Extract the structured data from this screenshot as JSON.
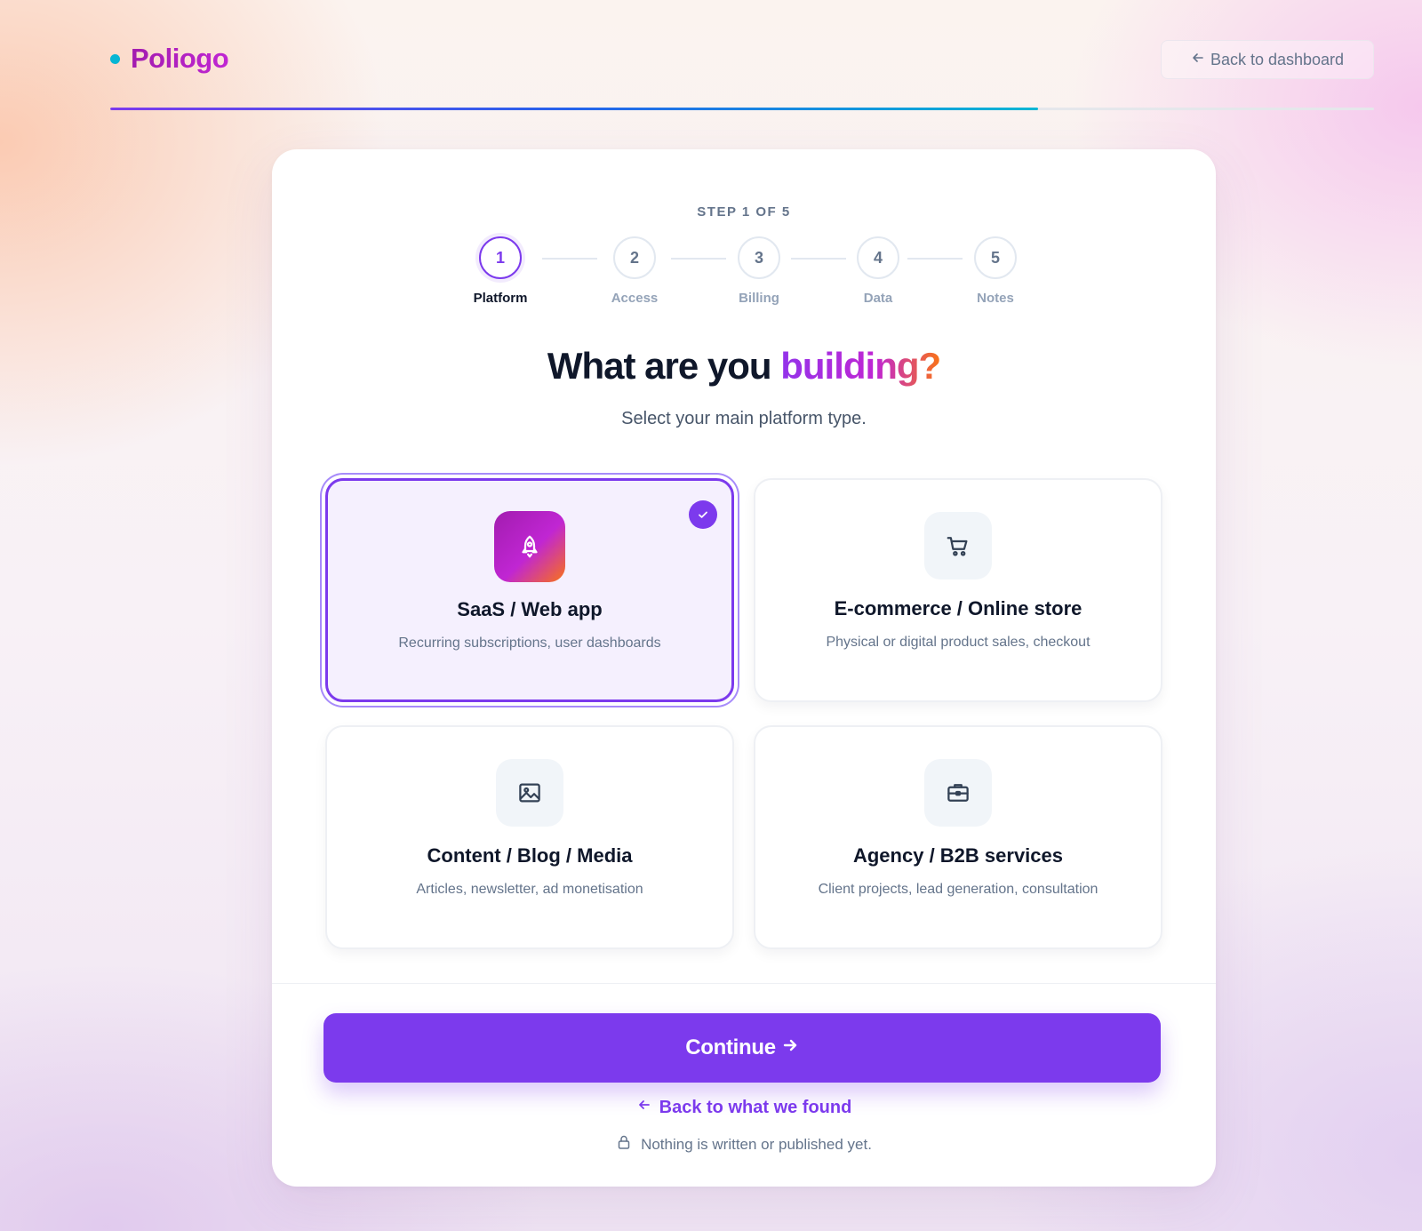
{
  "header": {
    "brand": "Poliogo",
    "back_dashboard": "Back to dashboard",
    "progress_fraction": 0.734
  },
  "wizard": {
    "step_label": "STEP 1 OF 5",
    "steps": [
      {
        "number": "1",
        "label": "Platform",
        "active": true
      },
      {
        "number": "2",
        "label": "Access",
        "active": false
      },
      {
        "number": "3",
        "label": "Billing",
        "active": false
      },
      {
        "number": "4",
        "label": "Data",
        "active": false
      },
      {
        "number": "5",
        "label": "Notes",
        "active": false
      }
    ],
    "title_main": "What are you ",
    "title_accent": "building?",
    "subtitle": "Select your main platform type.",
    "options": [
      {
        "title": "SaaS / Web app",
        "description": "Recurring subscriptions, user dashboards",
        "icon": "rocket-icon",
        "selected": true
      },
      {
        "title": "E-commerce / Online store",
        "description": "Physical or digital product sales, checkout",
        "icon": "shopping-cart-icon",
        "selected": false
      },
      {
        "title": "Content / Blog / Media",
        "description": "Articles, newsletter, ad monetisation",
        "icon": "image-icon",
        "selected": false
      },
      {
        "title": "Agency / B2B services",
        "description": "Client projects, lead generation, consultation",
        "icon": "briefcase-icon",
        "selected": false
      }
    ],
    "continue_label": "Continue",
    "back_label": "Back to what we found",
    "note": "Nothing is written or published yet."
  },
  "colors": {
    "accent": "#7c3aed",
    "brand": "#c026d3",
    "logo_dot": "#06b6d4"
  }
}
